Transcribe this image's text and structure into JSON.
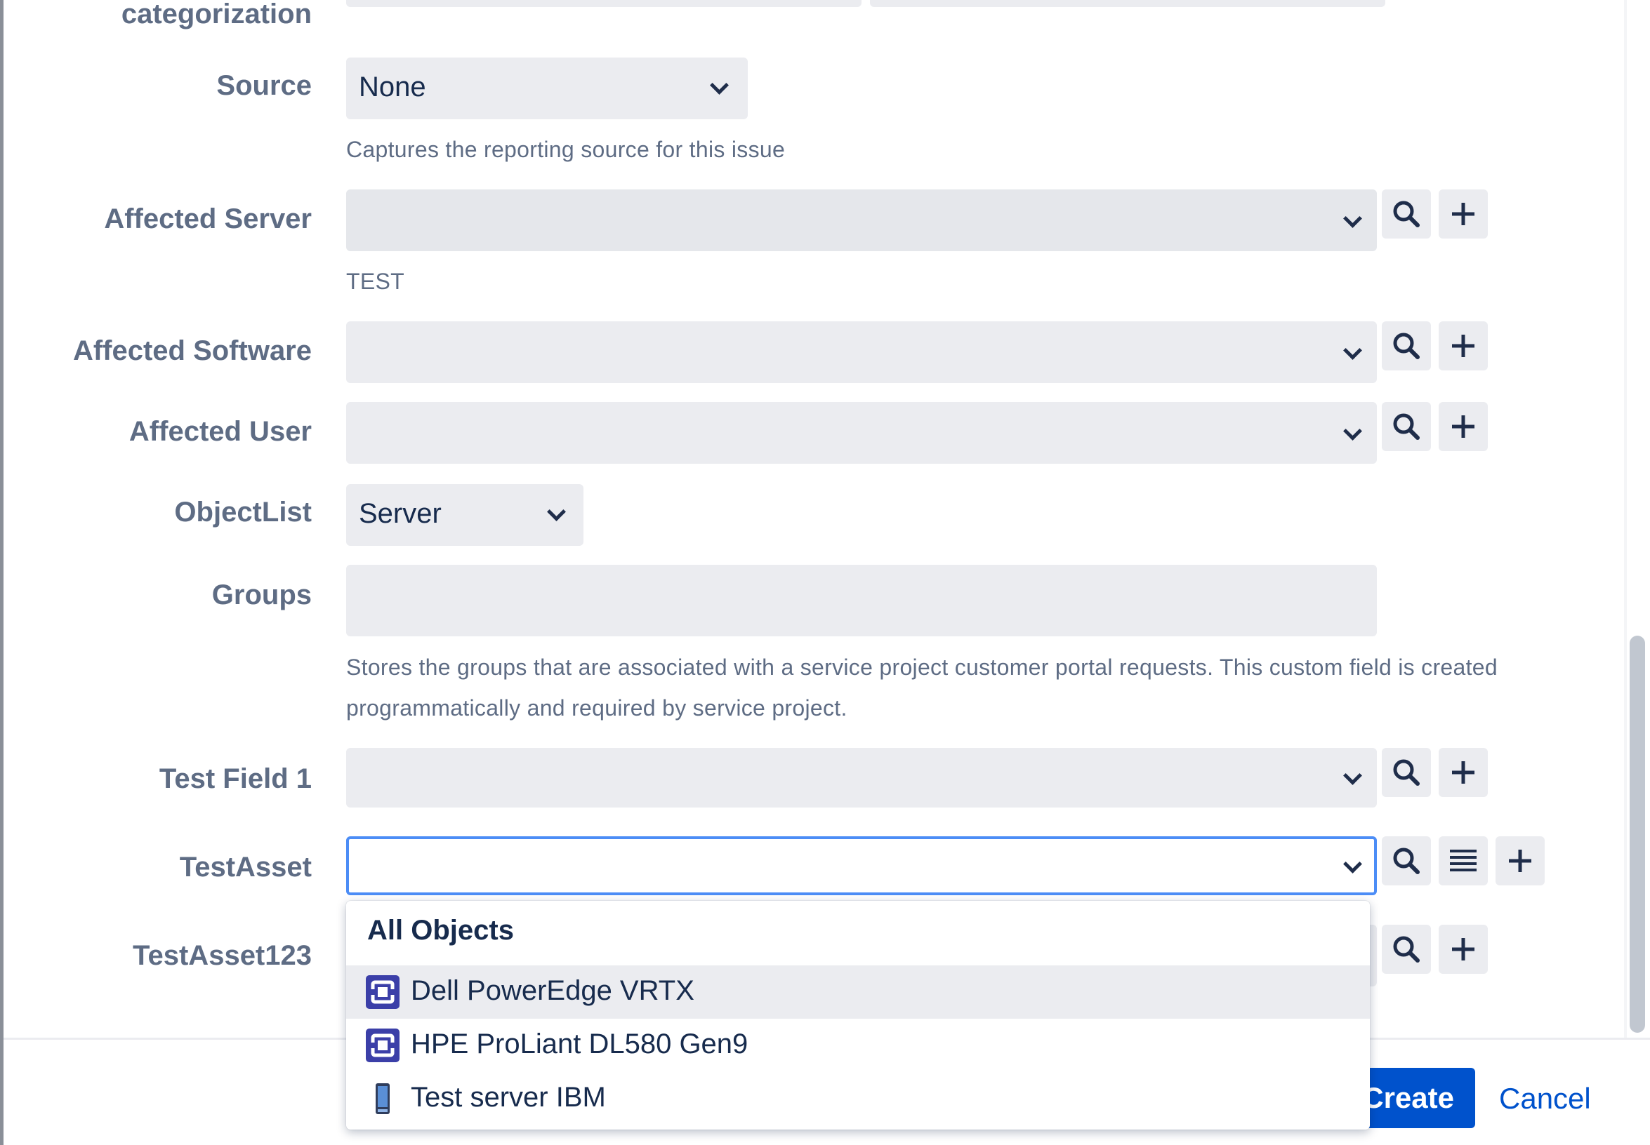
{
  "form": {
    "categorization_label": "categorization",
    "source": {
      "label": "Source",
      "value": "None",
      "help": "Captures the reporting source for this issue"
    },
    "affected_server": {
      "label": "Affected Server",
      "help": "TEST"
    },
    "affected_software": {
      "label": "Affected Software"
    },
    "affected_user": {
      "label": "Affected User"
    },
    "object_list": {
      "label": "ObjectList",
      "value": "Server"
    },
    "groups": {
      "label": "Groups",
      "help_line1": "Stores the groups that are associated with a service project customer portal requests. This custom field is created",
      "help_line2": "programmatically and required by service project."
    },
    "test_field_1": {
      "label": "Test Field 1"
    },
    "test_asset": {
      "label": "TestAsset"
    },
    "test_asset_123": {
      "label": "TestAsset123"
    }
  },
  "dropdown": {
    "header": "All Objects",
    "items": [
      {
        "label": "Dell PowerEdge VRTX",
        "icon": "object-type-icon",
        "highlighted": true
      },
      {
        "label": "HPE ProLiant DL580 Gen9",
        "icon": "object-type-icon",
        "highlighted": false
      },
      {
        "label": "Test server IBM",
        "icon": "server-icon",
        "highlighted": false
      }
    ]
  },
  "footer": {
    "create_label": "Create",
    "cancel_label": "Cancel"
  },
  "colors": {
    "primary": "#0052cc",
    "field_bg": "#ebecf0",
    "focus_border": "#4c9aff",
    "label": "#5e6c84"
  }
}
